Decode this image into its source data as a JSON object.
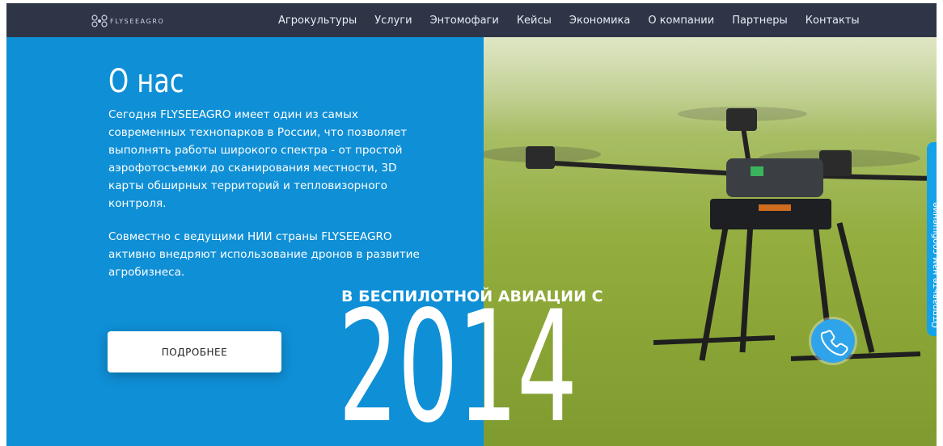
{
  "brand": {
    "name": "FLYSEEAGRO"
  },
  "nav": {
    "items": [
      "Агрокультуры",
      "Услуги",
      "Энтомофаги",
      "Кейсы",
      "Экономика",
      "О компании",
      "Партнеры",
      "Контакты"
    ]
  },
  "hero": {
    "title": "О нас",
    "paragraph1": "Сегодня FLYSEEAGRO имеет один из самых современных технопарков в России, что позволяет выполнять работы широкого спектра - от простой аэрофотосъемки до сканирования местности, 3D карты обширных территорий и тепловизорного контроля.",
    "paragraph2": "Совместно с ведущими НИИ страны FLYSEEAGRO активно внедряют использование дронов в развитие агробизнеса.",
    "button_label": "ПОДРОБНЕЕ",
    "since_label": "В БЕСПИЛОТНОЙ АВИАЦИИ С",
    "year": "2014"
  },
  "widgets": {
    "message_tab": "Отправьте нам сообщение",
    "phone_icon": "phone-icon"
  },
  "colors": {
    "nav_bg": "#2e3546",
    "hero_blue": "#0f8fd6",
    "widget_blue": "#2fa4ea"
  }
}
